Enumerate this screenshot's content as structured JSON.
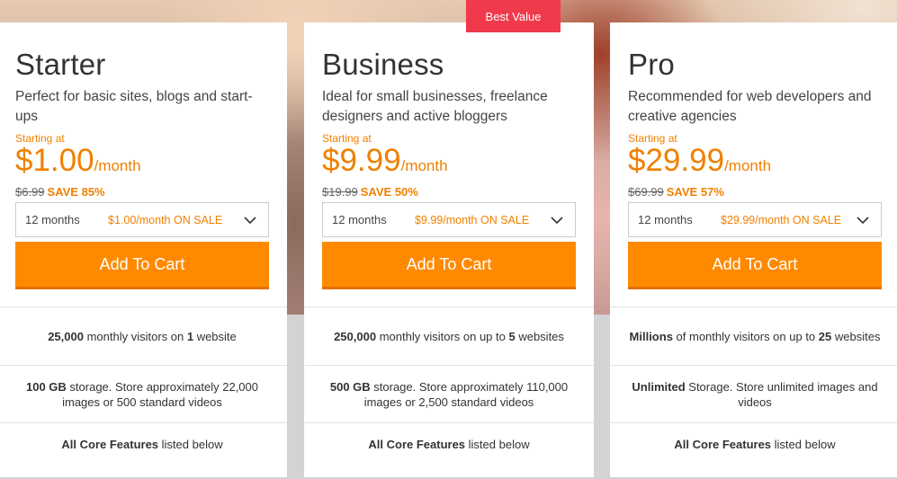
{
  "badge": "Best Value",
  "plans": [
    {
      "name": "Starter",
      "description": "Perfect for basic sites, blogs and start-ups",
      "starting_at": "Starting at",
      "price": "$1.00",
      "per": "/month",
      "old_price": "$6.99",
      "save": "SAVE 85%",
      "term": "12 months",
      "term_sale": "$1.00/month ON SALE",
      "cart_label": "Add To Cart",
      "features": {
        "visitors": {
          "bold": "25,000",
          "mid": " monthly visitors on ",
          "bold2": "1",
          "tail": " website"
        },
        "storage": {
          "bold": "100 GB",
          "tail": " storage. Store approximately 22,000 images or 500 standard videos"
        },
        "core": {
          "bold": "All Core Features",
          "tail": " listed below"
        }
      }
    },
    {
      "name": "Business",
      "description": "Ideal for small businesses, freelance designers and active bloggers",
      "starting_at": "Starting at",
      "price": "$9.99",
      "per": "/month",
      "old_price": "$19.99",
      "save": "SAVE 50%",
      "term": "12 months",
      "term_sale": "$9.99/month ON SALE",
      "cart_label": "Add To Cart",
      "features": {
        "visitors": {
          "bold": "250,000",
          "mid": " monthly visitors on up to ",
          "bold2": "5",
          "tail": " websites"
        },
        "storage": {
          "bold": "500 GB",
          "tail": " storage. Store approximately 110,000 images or 2,500 standard videos"
        },
        "core": {
          "bold": "All Core Features",
          "tail": " listed below"
        }
      }
    },
    {
      "name": "Pro",
      "description": "Recommended for web developers and creative agencies",
      "starting_at": "Starting at",
      "price": "$29.99",
      "per": "/month",
      "old_price": "$69.99",
      "save": "SAVE 57%",
      "term": "12 months",
      "term_sale": "$29.99/month ON SALE",
      "cart_label": "Add To Cart",
      "features": {
        "visitors": {
          "bold": "Millions",
          "mid": " of monthly visitors on up to ",
          "bold2": "25",
          "tail": " websites"
        },
        "storage": {
          "bold": "Unlimited",
          "tail": " Storage. Store unlimited images and videos"
        },
        "core": {
          "bold": "All Core Features",
          "tail": " listed below"
        }
      }
    }
  ],
  "colors": {
    "accent": "#ff8a00",
    "price_orange": "#f08000",
    "badge_red": "#f0394b"
  },
  "icons": {
    "dropdown": "chevron-down-icon"
  }
}
